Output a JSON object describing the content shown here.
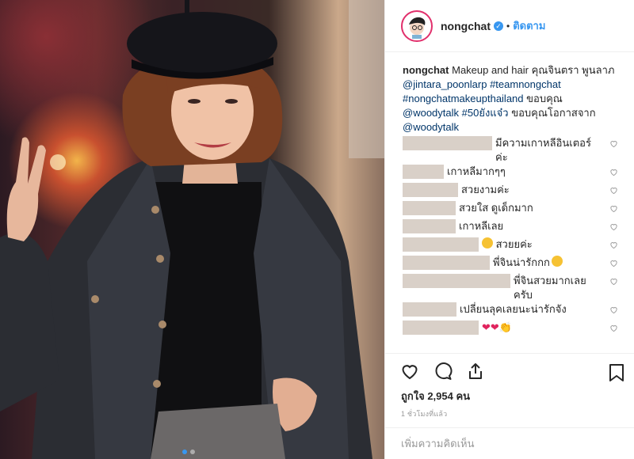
{
  "header": {
    "username": "nongchat",
    "separator": "•",
    "follow_label": "ติดตาม"
  },
  "caption": {
    "username": "nongchat",
    "text_1": "Makeup and hair คุณจินตรา พูนลาภ",
    "mention_1": "@jintara_poonlarp",
    "hashtag_1": "#teamnongchat",
    "hashtag_2": "#nongchatmakeupthailand",
    "text_2": "ขอบคุณ",
    "mention_2": "@woodytalk",
    "hashtag_3": "#50ยังแจ๋ว",
    "text_3": "ขอบคุณโอกาสจาก",
    "mention_3": "@woodytalk"
  },
  "comments": [
    {
      "text": "มีความเกาหลีอินเตอร์ ค่ะ"
    },
    {
      "text": "เกาหลีมากๆๆ"
    },
    {
      "text": "สวยงามค่ะ"
    },
    {
      "text": "สวยใส ดูเด็กมาก"
    },
    {
      "text": "เกาหลีเลย"
    },
    {
      "text": "สวยยค่ะ"
    },
    {
      "text": "พี่จินน่ารักกก"
    },
    {
      "text": "พี่จินสวยมากเลย ครับ"
    },
    {
      "text": "เปลี่ยนลุคเลยนะน่ารักจัง"
    },
    {
      "text": "❤❤👏"
    }
  ],
  "likes": {
    "text": "ถูกใจ 2,954 คน"
  },
  "time": {
    "text": "1 ชั่วโมงที่แล้ว"
  },
  "add_comment": {
    "placeholder": "เพิ่มความคิดเห็น"
  },
  "colors": {
    "accent": "#3897f0",
    "mention": "#003569",
    "redacted": "#d9d0c8"
  },
  "icons": [
    "heart-icon",
    "comment-icon",
    "share-icon",
    "bookmark-icon",
    "verified-badge-icon"
  ]
}
